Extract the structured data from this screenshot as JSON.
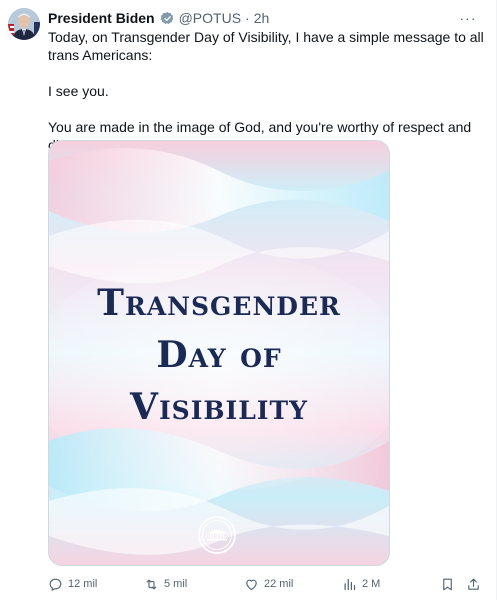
{
  "tweet": {
    "author_name": "President Biden",
    "handle": "@POTUS",
    "separator": "·",
    "time": "2h",
    "more_label": "···",
    "text_line1": "Today, on Transgender Day of Visibility, I have a simple message to all trans Americans:",
    "text_line2": "I see you.",
    "text_line3": "You are made in the image of God, and you're worthy of respect and dignity."
  },
  "media": {
    "title_line1": "Transgender",
    "title_line2": "Day of",
    "title_line3": "Visibility"
  },
  "actions": {
    "replies": "12 mil",
    "reposts": "5 mil",
    "likes": "22 mil",
    "views": "2 M"
  },
  "colors": {
    "verified_badge": "#829aab",
    "title_navy": "#1b2a55",
    "muted": "#536471"
  },
  "icons": [
    "verified-badge-icon",
    "more-icon",
    "reply-icon",
    "repost-icon",
    "like-icon",
    "views-icon",
    "bookmark-icon",
    "share-icon",
    "white-house-logo"
  ]
}
